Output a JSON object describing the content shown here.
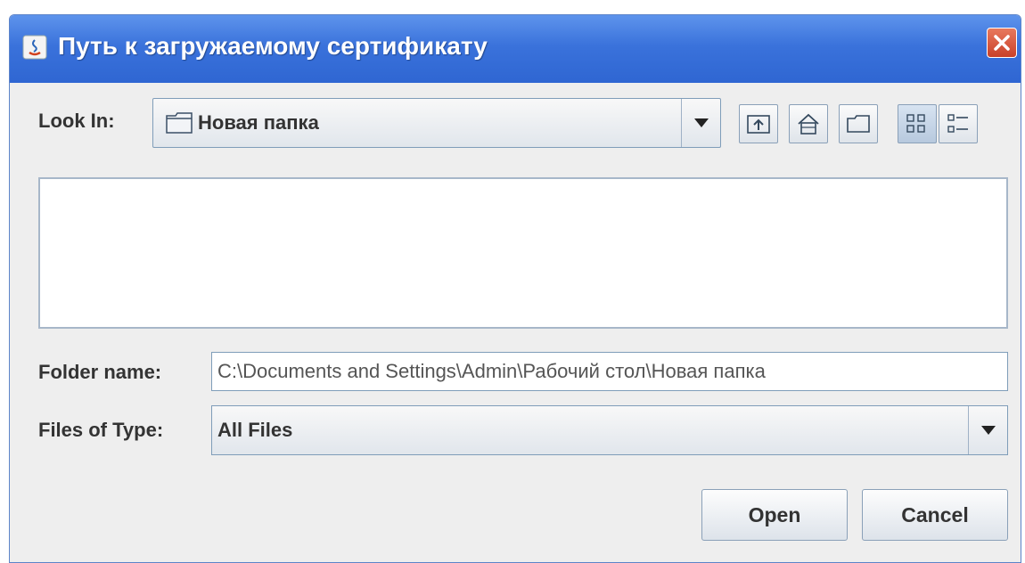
{
  "window": {
    "title": "Путь к загружаемому сертификату"
  },
  "look_in": {
    "label": "Look In:",
    "value": "Новая папка"
  },
  "toolbar": {
    "icons": [
      "up-folder-icon",
      "home-icon",
      "new-folder-icon",
      "list-view-icon",
      "details-view-icon"
    ]
  },
  "folder_name": {
    "label": "Folder name:",
    "value": "C:\\Documents and Settings\\Admin\\Рабочий стол\\Новая папка"
  },
  "files_of_type": {
    "label": "Files of Type:",
    "value": "All Files"
  },
  "buttons": {
    "open": "Open",
    "cancel": "Cancel"
  },
  "colors": {
    "titlebar": "#3a72db",
    "close": "#c9412a",
    "dialog_bg": "#eeeeee"
  }
}
